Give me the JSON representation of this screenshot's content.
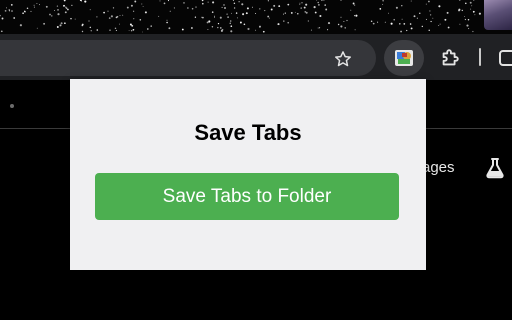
{
  "browser": {
    "toolbar_icons": [
      "star-icon",
      "save-tabs-extension-icon",
      "puzzle-icon",
      "window-icon"
    ]
  },
  "page": {
    "partial_link_text": "ages",
    "icons": [
      "flask-icon"
    ]
  },
  "popup": {
    "title": "Save Tabs",
    "button_label": "Save Tabs to Folder",
    "accent_color": "#4caf50"
  }
}
